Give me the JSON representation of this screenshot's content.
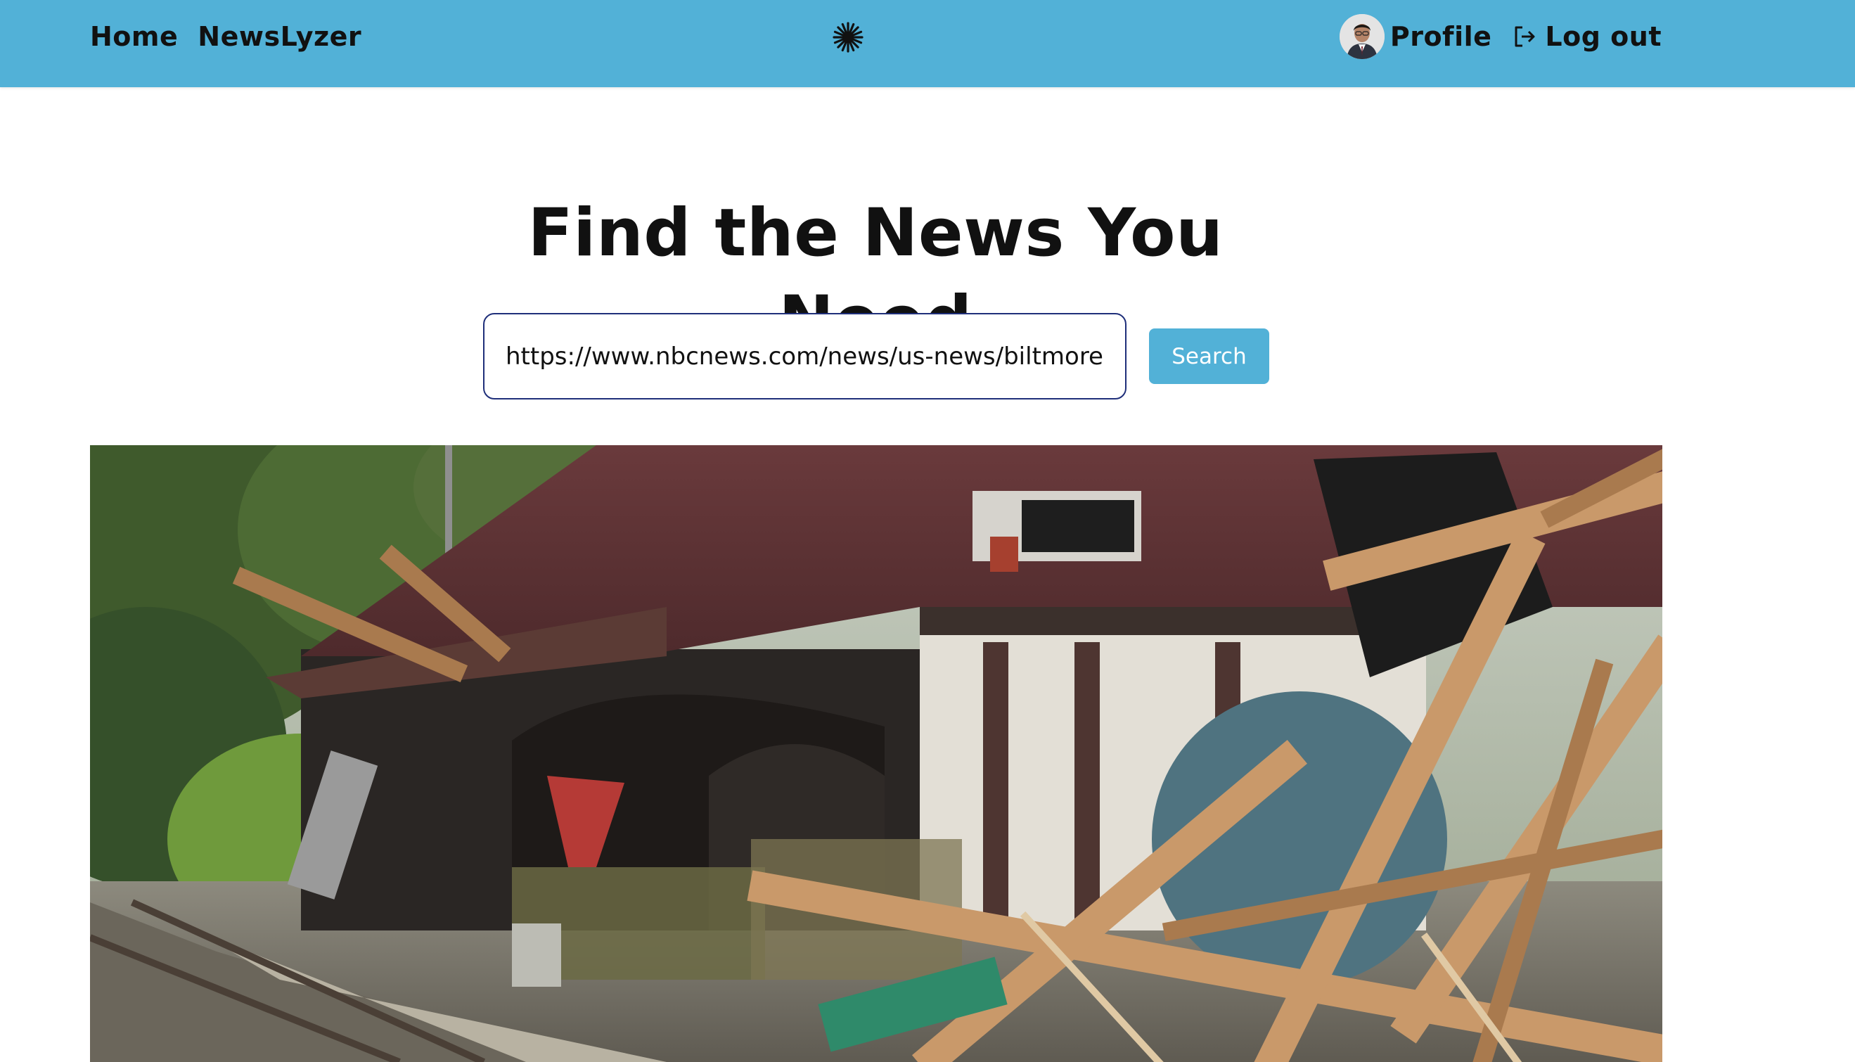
{
  "nav": {
    "home_label": "Home",
    "brand_label": "NewsLyzer",
    "profile_label": "Profile",
    "logout_label": "Log out",
    "logo_icon": "asterisk-icon"
  },
  "hero": {
    "title": "Find the News You Need"
  },
  "search": {
    "value": "https://www.nbcnews.com/news/us-news/biltmore",
    "button_label": "Search"
  },
  "article": {
    "image_subject": "storm-damaged railway station with debris"
  },
  "colors": {
    "navbar": "#52b1d7",
    "button": "#52b1d7",
    "input_border": "#1f2f7a",
    "text": "#111111"
  }
}
